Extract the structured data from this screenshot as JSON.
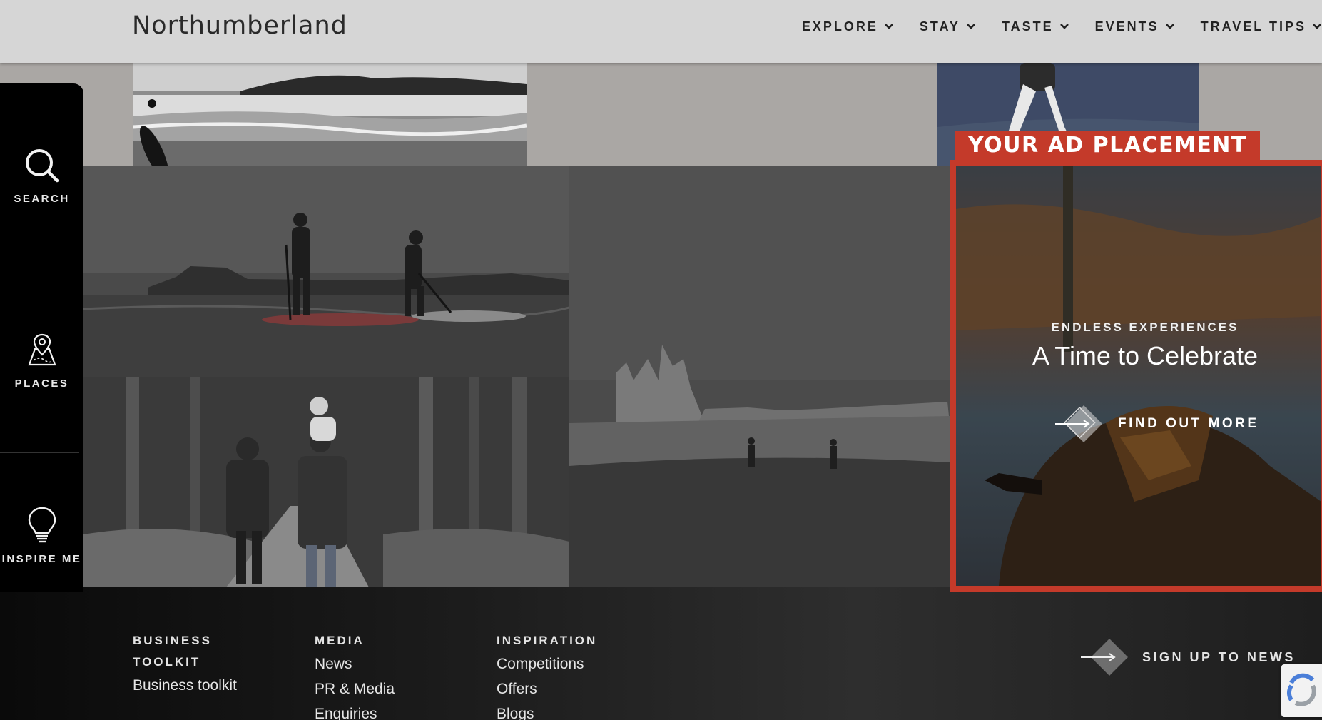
{
  "header": {
    "logo": "Northumberland",
    "nav": [
      {
        "label": "EXPLORE"
      },
      {
        "label": "STAY"
      },
      {
        "label": "TASTE"
      },
      {
        "label": "EVENTS"
      },
      {
        "label": "TRAVEL TIPS"
      }
    ]
  },
  "rail": {
    "search": "SEARCH",
    "places": "PLACES",
    "inspire": "INSPIRE ME"
  },
  "ad": {
    "tag": "YOUR AD PLACEMENT",
    "kicker": "ENDLESS EXPERIENCES",
    "title": "A Time to Celebrate",
    "cta": "FIND OUT MORE"
  },
  "footer": {
    "columns": [
      {
        "heading_line1": "BUSINESS",
        "heading_line2": "TOOLKIT",
        "links": [
          "Business toolkit"
        ]
      },
      {
        "heading": "MEDIA",
        "links": [
          "News",
          "PR & Media",
          "Enquiries"
        ]
      },
      {
        "heading": "INSPIRATION",
        "links": [
          "Competitions",
          "Offers",
          "Blogs"
        ]
      }
    ],
    "signup": "SIGN UP TO NEWS"
  },
  "colors": {
    "accent": "#c43a2a",
    "header_bg": "#d6d6d6",
    "rail_bg": "#000000"
  }
}
